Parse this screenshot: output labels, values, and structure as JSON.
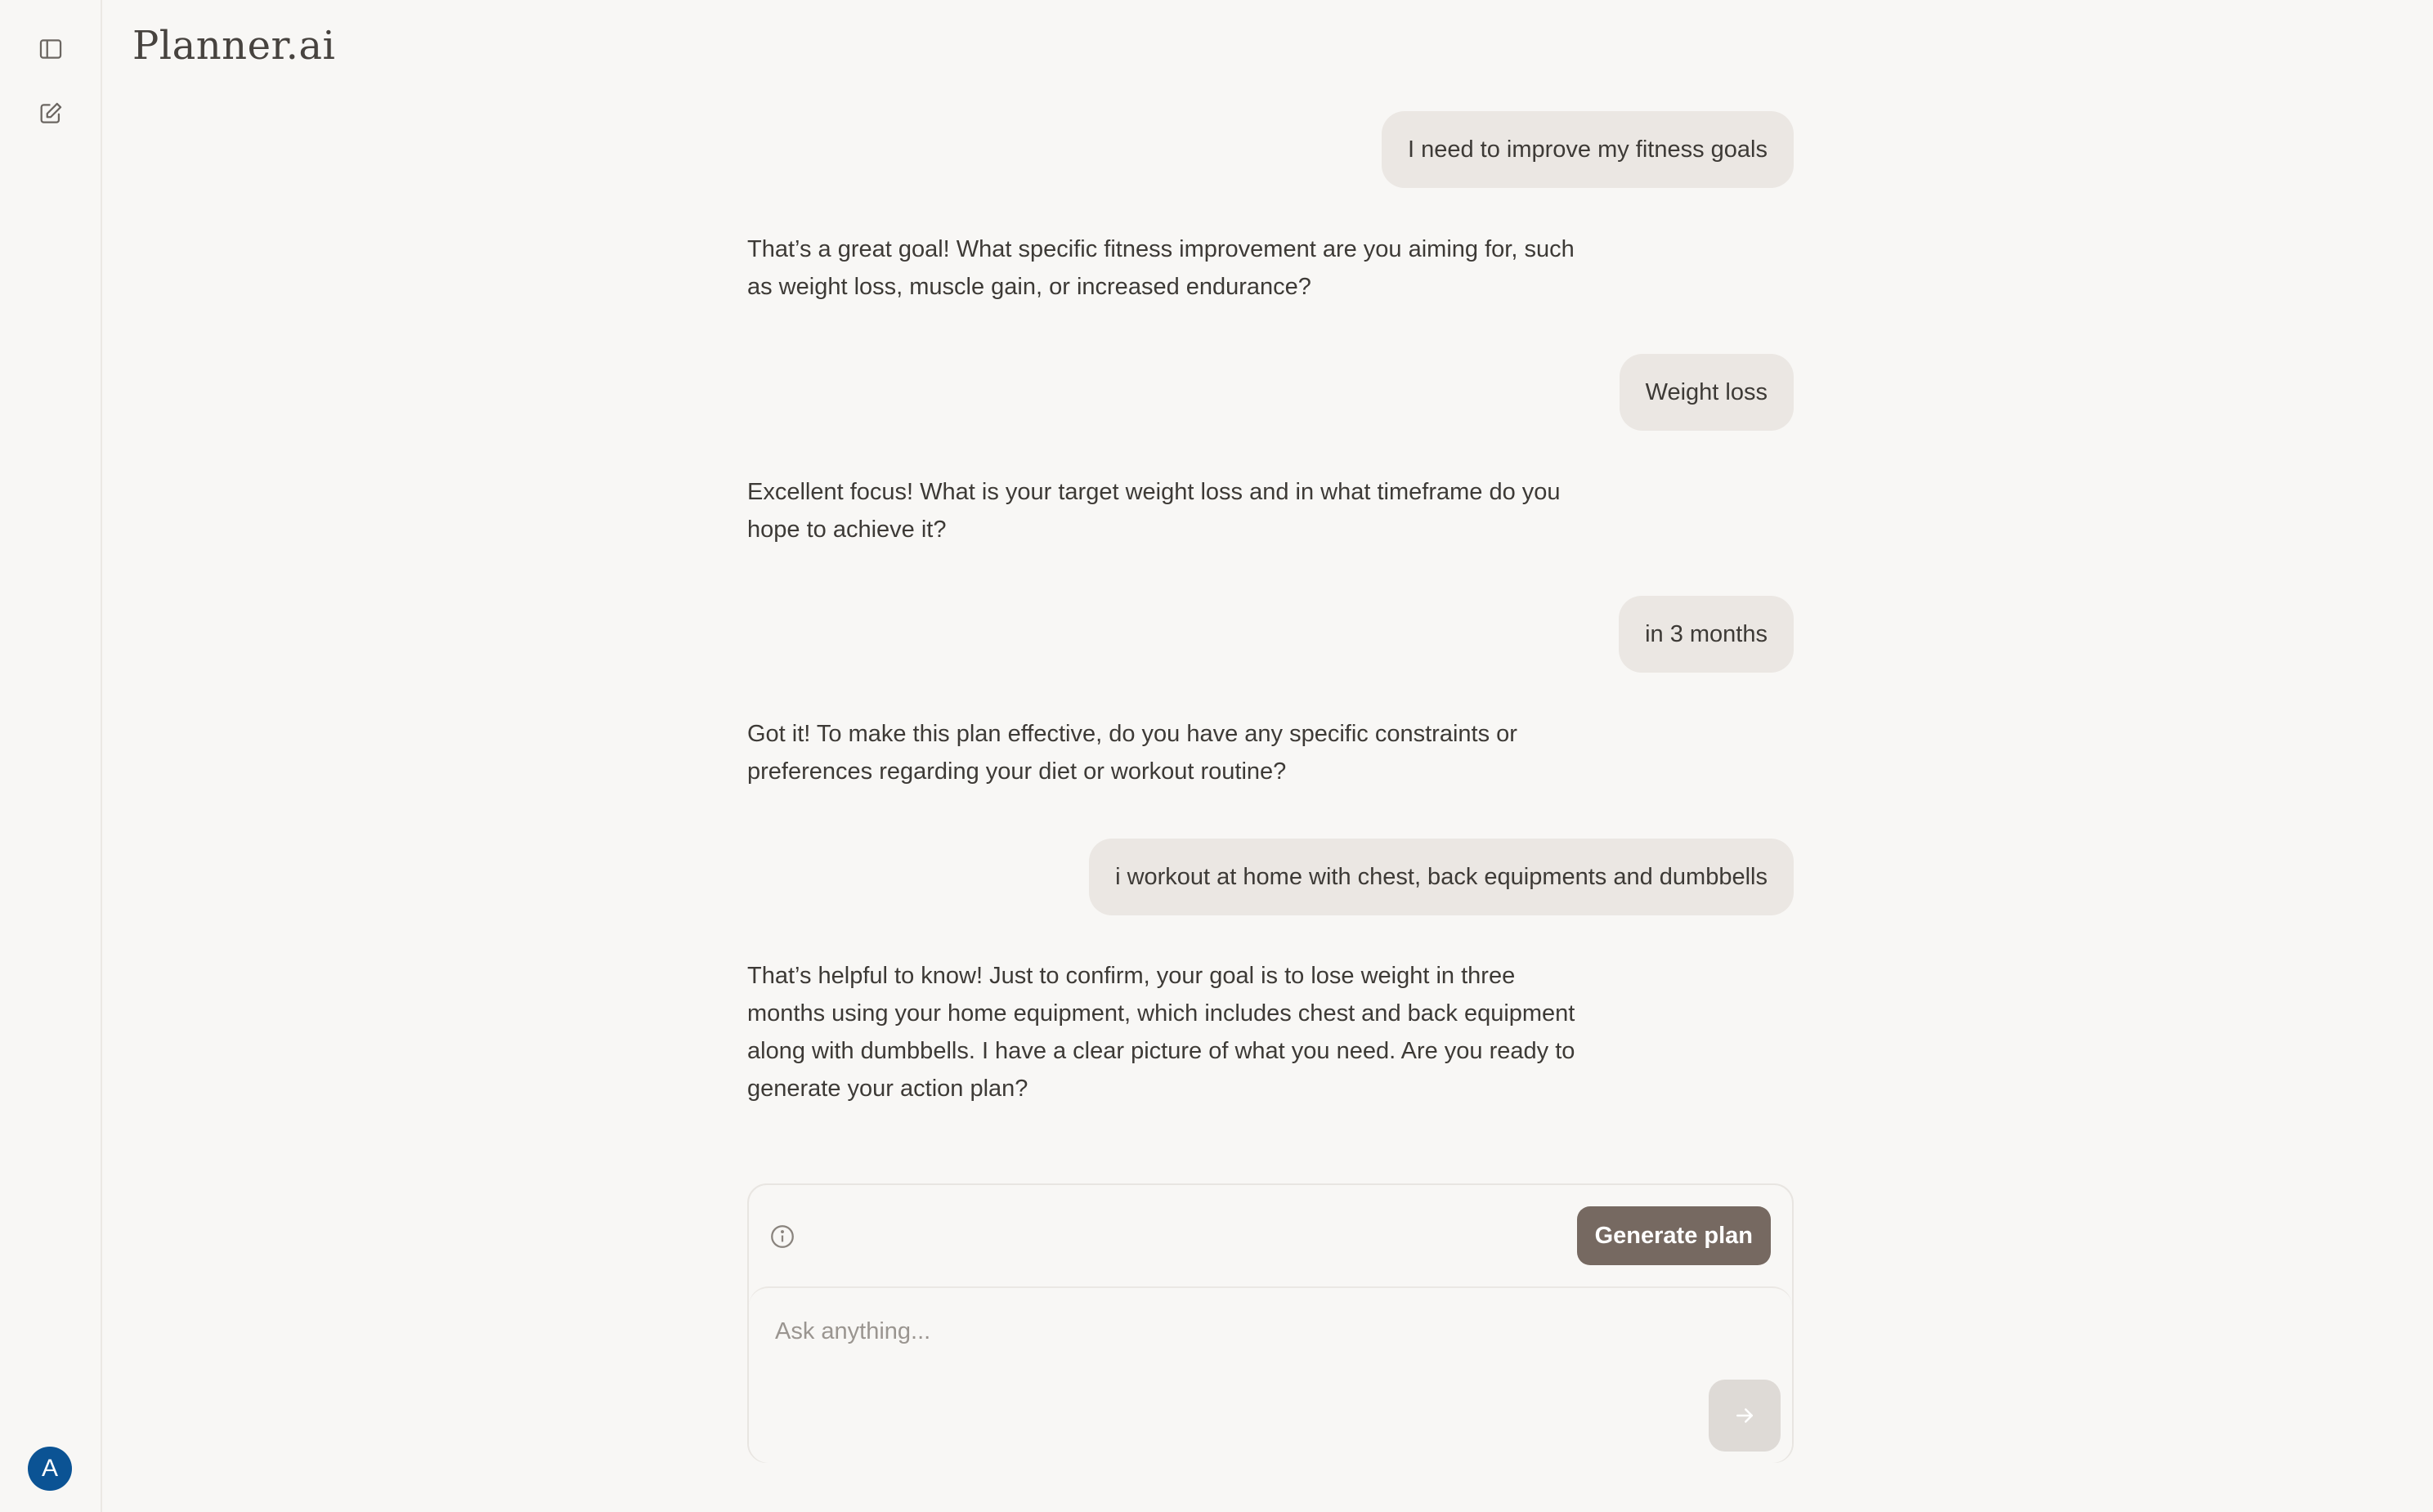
{
  "app": {
    "title": "Planner.ai",
    "avatar_initial": "A"
  },
  "sidebar": {
    "icons": [
      "sidebar-toggle-icon",
      "new-chat-icon"
    ]
  },
  "conversation": {
    "messages": [
      {
        "role": "user",
        "text": "I need to improve my fitness goals"
      },
      {
        "role": "assistant",
        "text": "That’s a great goal! What specific fitness improvement are you aiming for, such as weight loss, muscle gain, or increased endurance?"
      },
      {
        "role": "user",
        "text": "Weight loss"
      },
      {
        "role": "assistant",
        "text": "Excellent focus! What is your target weight loss and in what timeframe do you hope to achieve it?"
      },
      {
        "role": "user",
        "text": "in 3 months"
      },
      {
        "role": "assistant",
        "text": "Got it! To make this plan effective, do you have any specific constraints or preferences regarding your diet or workout routine?"
      },
      {
        "role": "user",
        "text": "i workout at home with chest, back equipments and dumbbells"
      },
      {
        "role": "assistant",
        "text": "That’s helpful to know! Just to confirm, your goal is to lose weight in three months using your home equipment, which includes chest and back equipment along with dumbbells. I have a clear picture of what you need. Are you ready to generate your action plan?"
      }
    ]
  },
  "composer": {
    "generate_label": "Generate plan",
    "placeholder": "Ask anything...",
    "value": ""
  },
  "colors": {
    "background": "#f8f7f5",
    "user_bubble": "#ebe7e3",
    "primary_button": "#766961",
    "avatar": "#0b5394",
    "send_button": "#dedad6"
  }
}
